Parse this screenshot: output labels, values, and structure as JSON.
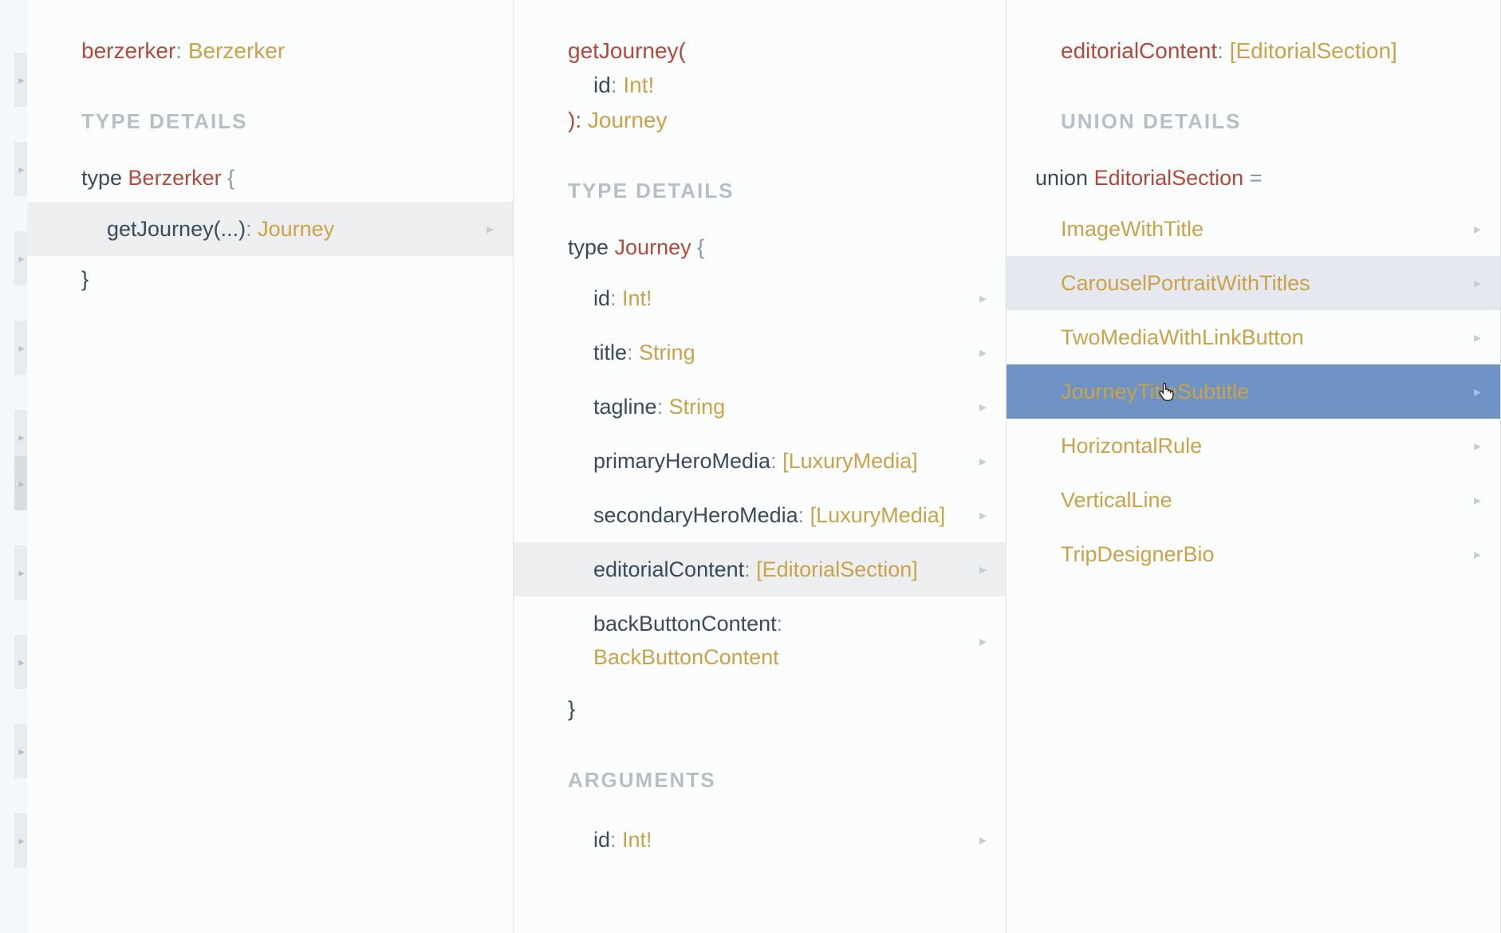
{
  "col1": {
    "header_field": "berzerker",
    "header_sep": ": ",
    "header_type": "Berzerker",
    "section": "TYPE DETAILS",
    "open_line_pre": "type ",
    "open_line_type": "Berzerker",
    "open_line_post": " {",
    "field_row_name": "getJourney(...)",
    "field_row_sep": ": ",
    "field_row_type": "Journey",
    "close_line": "}"
  },
  "col2": {
    "header_l1_field": "getJourney(",
    "header_l2_param": "id",
    "header_l2_sep": ": ",
    "header_l2_type": "Int!",
    "header_l3_close": "): ",
    "header_l3_type": "Journey",
    "section1": "TYPE DETAILS",
    "open_line_pre": "type ",
    "open_line_type": "Journey",
    "open_line_post": " {",
    "fields": [
      {
        "name": "id",
        "type": "Int!"
      },
      {
        "name": "title",
        "type": "String"
      },
      {
        "name": "tagline",
        "type": "String"
      },
      {
        "name": "primaryHeroMedia",
        "type": "[LuxuryMedia]"
      },
      {
        "name": "secondaryHeroMedia",
        "type": "[LuxuryMedia]"
      },
      {
        "name": "editorialContent",
        "type": "[EditorialSection]"
      },
      {
        "name": "backButtonContent",
        "type": "BackButtonContent"
      }
    ],
    "close_line": "}",
    "section2": "ARGUMENTS",
    "arg_name": "id",
    "arg_sep": ": ",
    "arg_type": "Int!"
  },
  "col3": {
    "header_field": "editorialContent",
    "header_sep": ": ",
    "header_type": "[EditorialSection]",
    "section": "UNION DETAILS",
    "open_line_pre": "union ",
    "open_line_type": "EditorialSection",
    "open_line_post": " =",
    "members": [
      {
        "name": "ImageWithTitle",
        "state": ""
      },
      {
        "name": "CarouselPortraitWithTitles",
        "state": "visited"
      },
      {
        "name": "TwoMediaWithLinkButton",
        "state": ""
      },
      {
        "name": "JourneyTitleSubtitle",
        "state": "selected"
      },
      {
        "name": "HorizontalRule",
        "state": ""
      },
      {
        "name": "VerticalLine",
        "state": ""
      },
      {
        "name": "TripDesignerBio",
        "state": ""
      }
    ]
  },
  "glyphs": {
    "arrow": "▸",
    "cursor": "↖"
  }
}
